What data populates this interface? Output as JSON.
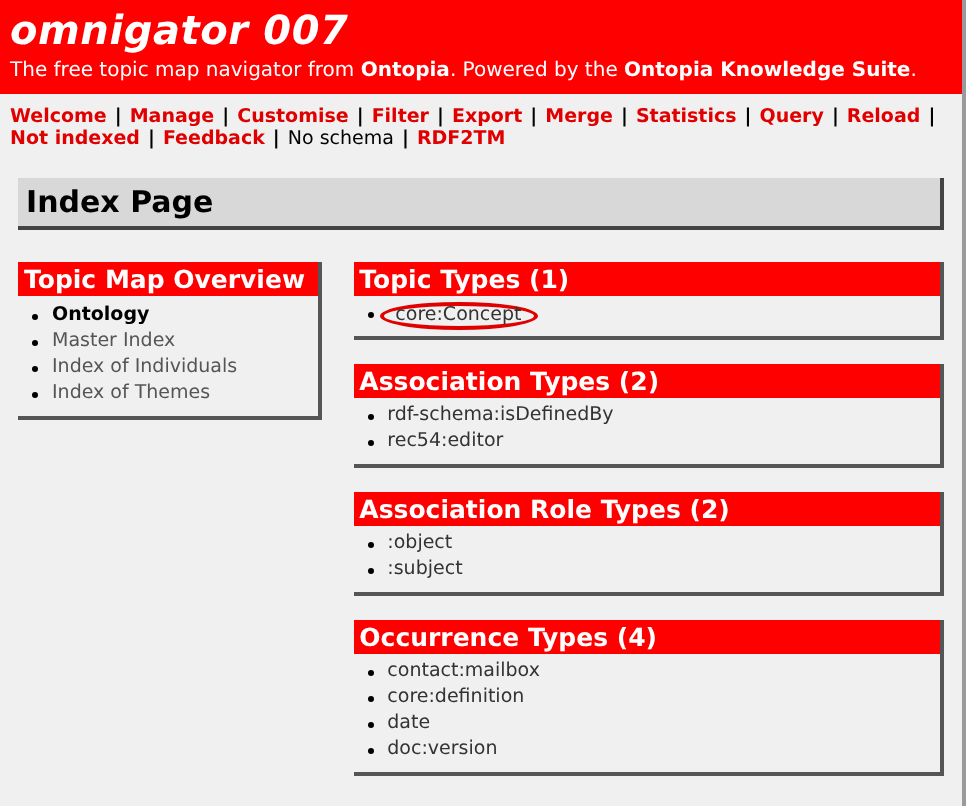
{
  "header": {
    "title": "omnigator 007",
    "subtitle": "The free topic map navigator from **Ontopia**. Powered by the **Ontopia Knowledge Suite**."
  },
  "nav": {
    "separator": "|",
    "items": [
      {
        "label": "Welcome",
        "kind": "link"
      },
      {
        "label": "Manage",
        "kind": "link"
      },
      {
        "label": "Customise",
        "kind": "link"
      },
      {
        "label": "Filter",
        "kind": "link"
      },
      {
        "label": "Export",
        "kind": "link"
      },
      {
        "label": "Merge",
        "kind": "link"
      },
      {
        "label": "Statistics",
        "kind": "link"
      },
      {
        "label": "Query",
        "kind": "link"
      },
      {
        "label": "Reload",
        "kind": "link"
      },
      {
        "label": "Not indexed",
        "kind": "link"
      },
      {
        "label": "Feedback",
        "kind": "link"
      },
      {
        "label": "No schema",
        "kind": "plain"
      },
      {
        "label": "RDF2TM",
        "kind": "link"
      }
    ]
  },
  "page_title": "Index Page",
  "overview": {
    "title": "Topic Map Overview",
    "items": [
      {
        "label": "Ontology",
        "current": true
      },
      {
        "label": "Master Index",
        "current": false
      },
      {
        "label": "Index of Individuals",
        "current": false
      },
      {
        "label": "Index of Themes",
        "current": false
      }
    ]
  },
  "sections": [
    {
      "title": "Topic Types (1)",
      "items": [
        {
          "label": "core:Concept",
          "circled": true
        }
      ]
    },
    {
      "title": "Association Types (2)",
      "items": [
        {
          "label": "rdf-schema:isDefinedBy",
          "circled": false
        },
        {
          "label": "rec54:editor",
          "circled": false
        }
      ]
    },
    {
      "title": "Association Role Types (2)",
      "items": [
        {
          "label": ":object",
          "circled": false
        },
        {
          "label": ":subject",
          "circled": false
        }
      ]
    },
    {
      "title": "Occurrence Types (4)",
      "items": [
        {
          "label": "contact:mailbox",
          "circled": false
        },
        {
          "label": "core:definition",
          "circled": false
        },
        {
          "label": "date",
          "circled": false
        },
        {
          "label": "doc:version",
          "circled": false
        }
      ]
    }
  ]
}
